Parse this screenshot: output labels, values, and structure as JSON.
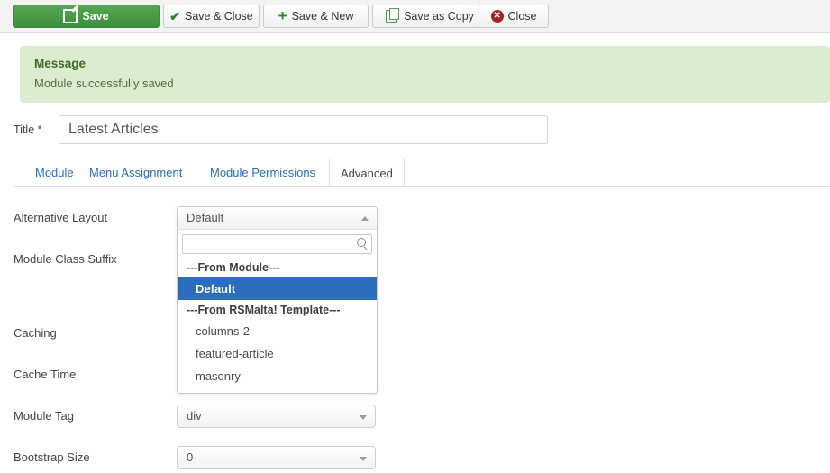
{
  "toolbar": {
    "buttons": [
      {
        "label": "Save",
        "icon": "edit-icon"
      },
      {
        "label": "Save & Close",
        "icon": "check-icon"
      },
      {
        "label": "Save & New",
        "icon": "plus-icon"
      },
      {
        "label": "Save as Copy",
        "icon": "copy-icon"
      },
      {
        "label": "Close",
        "icon": "close-circle-icon"
      }
    ]
  },
  "message": {
    "title": "Message",
    "text": "Module successfully saved",
    "background": "#dcecd0",
    "title_color": "#3d6b27"
  },
  "title_field": {
    "label": "Title *",
    "value": "Latest Articles",
    "placeholder": ""
  },
  "tabs": [
    {
      "label": "Module",
      "active": false
    },
    {
      "label": "Menu Assignment",
      "active": false
    },
    {
      "label": "Module Permissions",
      "active": false
    },
    {
      "label": "Advanced",
      "active": true
    }
  ],
  "form": {
    "labels": {
      "alternative_layout": "Alternative Layout",
      "module_class_suffix": "Module Class Suffix",
      "caching": "Caching",
      "cache_time": "Cache Time",
      "module_tag": "Module Tag",
      "bootstrap_size": "Bootstrap Size"
    },
    "module_tag": {
      "value": "div"
    },
    "bootstrap_size": {
      "value": "0"
    }
  },
  "alternative_layout_dropdown": {
    "selected": "Default",
    "open": true,
    "search_value": "",
    "search_placeholder": "",
    "highlight_color": "#2b6ebd",
    "groups": [
      {
        "label": "---From Module---",
        "options": [
          {
            "label": "Default",
            "selected": true
          }
        ]
      },
      {
        "label": "---From RSMalta! Template---",
        "options": [
          {
            "label": "columns-2",
            "selected": false
          },
          {
            "label": "featured-article",
            "selected": false
          },
          {
            "label": "masonry",
            "selected": false
          }
        ]
      }
    ]
  }
}
